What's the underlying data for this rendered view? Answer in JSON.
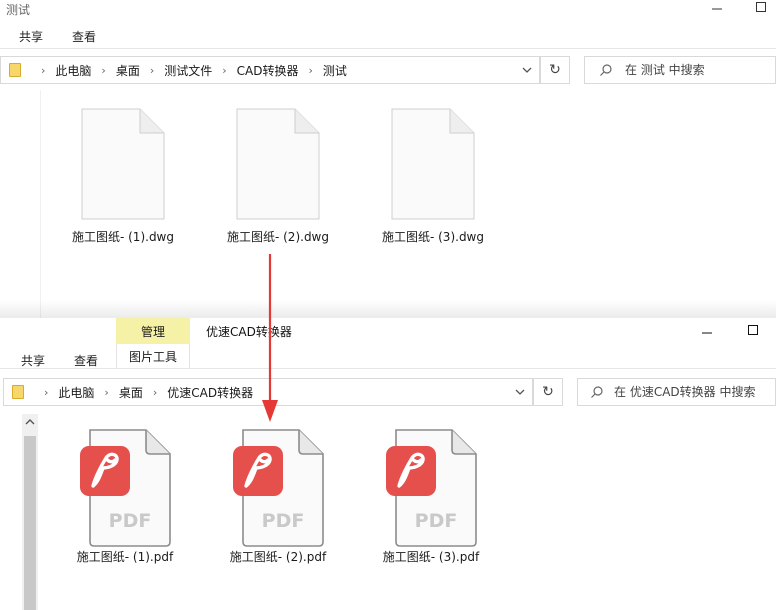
{
  "window_top": {
    "title": "测试",
    "tabs": [
      "共享",
      "查看"
    ],
    "breadcrumb": [
      "此电脑",
      "桌面",
      "测试文件",
      "CAD转换器",
      "测试"
    ],
    "search_placeholder": "在 测试 中搜索",
    "files": [
      "施工图纸- (1).dwg",
      "施工图纸- (2).dwg",
      "施工图纸- (3).dwg"
    ]
  },
  "window_bottom": {
    "context_tab": "管理",
    "title": "优速CAD转换器",
    "tabs": [
      "共享",
      "查看"
    ],
    "context_sub_tab": "图片工具",
    "breadcrumb": [
      "此电脑",
      "桌面",
      "优速CAD转换器"
    ],
    "search_placeholder": "在 优速CAD转换器 中搜索",
    "files": [
      "施工图纸- (1).pdf",
      "施工图纸- (2).pdf",
      "施工图纸- (3).pdf"
    ],
    "pdf_label": "PDF"
  },
  "colors": {
    "pdf_red": "#e5504d",
    "arrow_red": "#e53935",
    "manage_tab_bg": "#f5f2a8"
  },
  "icons": [
    "folder-icon",
    "chevron-right-icon",
    "chevron-down-icon",
    "refresh-icon",
    "search-icon",
    "minimize-icon",
    "maximize-icon",
    "pdf-file-icon",
    "dwg-file-icon",
    "scroll-up-icon"
  ]
}
